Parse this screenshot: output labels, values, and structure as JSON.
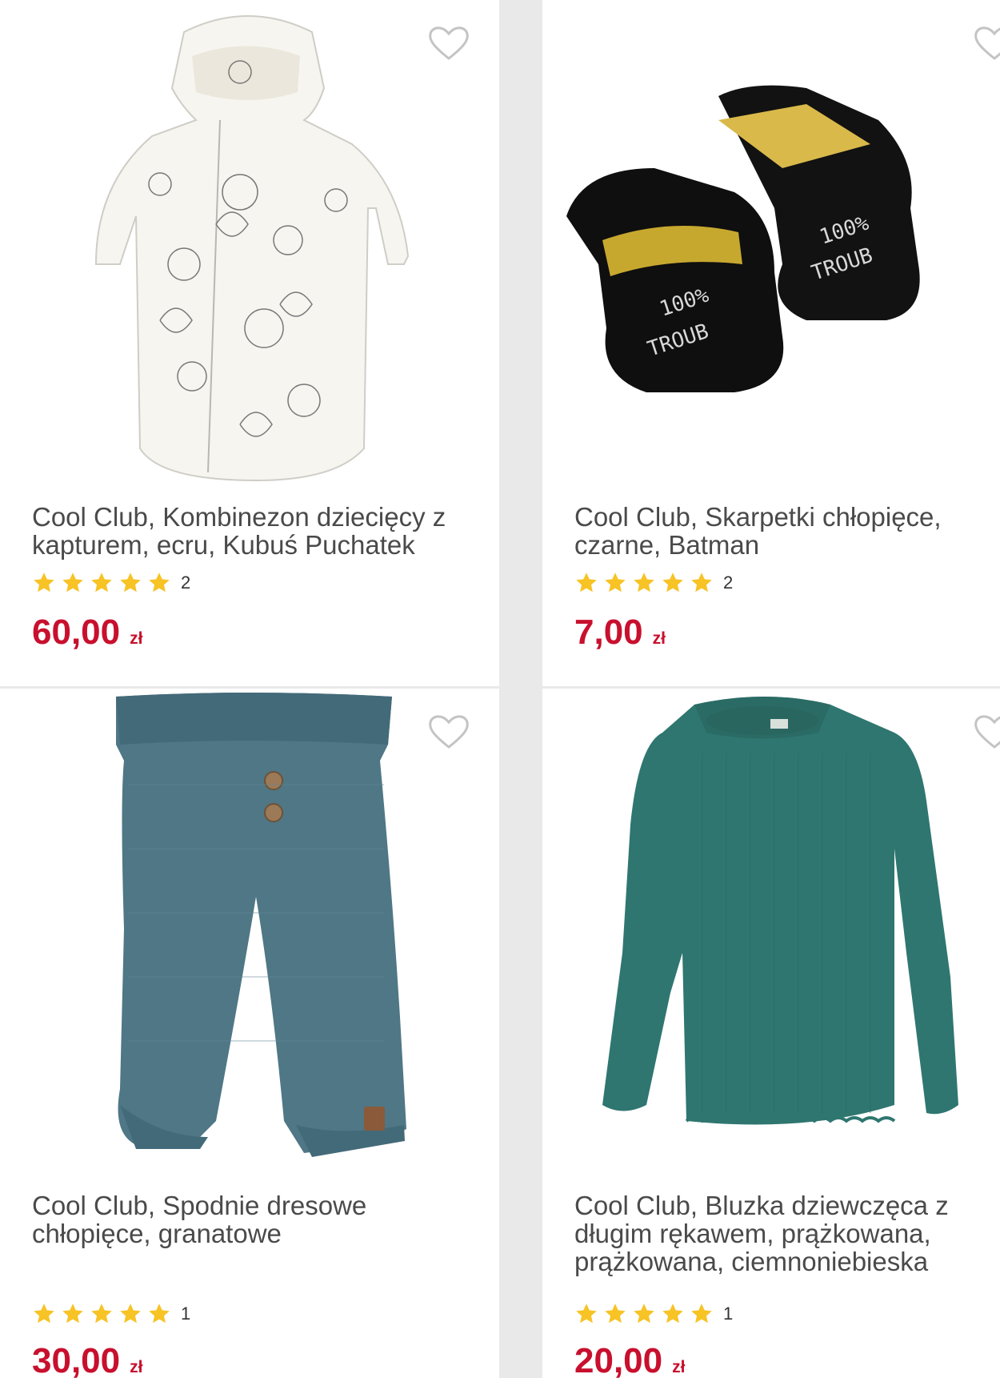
{
  "theme": {
    "price_color": "#c8102e",
    "star_color": "#f7c325",
    "title_color": "#4a4a4a"
  },
  "products": [
    {
      "image": "ecru winnie-the-pooh print hooded snowsuit",
      "wishlist_icon": "heart-outline-icon",
      "title": "Cool Club, Kombinezon dziecięcy z kapturem, ecru, Kubuś Puchatek",
      "rating": 5,
      "reviews": "2",
      "price": "60,00",
      "currency": "zł"
    },
    {
      "image": "black batman baby booties",
      "wishlist_icon": "heart-outline-icon",
      "title": "Cool Club, Skarpetki chłopięce, czarne, Batman",
      "rating": 5,
      "reviews": "2",
      "price": "7,00",
      "currency": "zł"
    },
    {
      "image": "blue knitted baby trousers with buttons",
      "wishlist_icon": "heart-outline-icon",
      "title": "Cool Club, Spodnie dresowe chłopięce, granatowe",
      "rating": 5,
      "reviews": "1",
      "price": "30,00",
      "currency": "zł"
    },
    {
      "image": "teal ribbed long-sleeve top",
      "wishlist_icon": "heart-outline-icon",
      "title": "Cool Club, Bluzka dziewczęca z długim rękawem, prążkowana, prążkowana, ciemnoniebieska",
      "rating": 5,
      "reviews": "1",
      "price": "20,00",
      "currency": "zł"
    }
  ]
}
